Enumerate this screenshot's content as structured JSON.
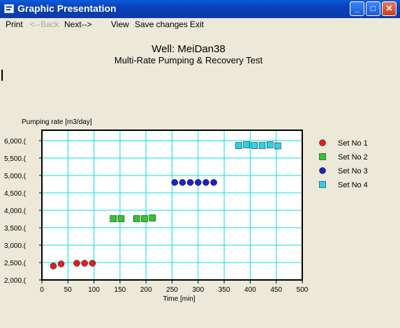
{
  "window": {
    "title": "Graphic Presentation",
    "buttons": {
      "minimize": "_",
      "maximize": "□",
      "close": "✕"
    }
  },
  "menu": {
    "print": "Print",
    "back": "<--Back",
    "next": "Next-->",
    "view": "View",
    "save_changes": "Save changes",
    "exit": "Exit"
  },
  "chart_data": {
    "type": "scatter",
    "title": "Well: MeiDan38",
    "subtitle": "Multi-Rate Pumping & Recovery Test",
    "ylabel": "Pumping rate [m3/day]",
    "xlabel": "Time [min]",
    "xlim": [
      0,
      500
    ],
    "ylim": [
      2000,
      6300
    ],
    "xticks": [
      0,
      50,
      100,
      150,
      200,
      250,
      300,
      350,
      400,
      450,
      500
    ],
    "yticks": [
      2000,
      2500,
      3000,
      3500,
      4000,
      4500,
      5000,
      5500,
      6000
    ],
    "ytick_labels": [
      "2,000.(",
      "2,500.(",
      "3,000.(",
      "3,500.(",
      "4,000.(",
      "4,500.(",
      "5,000.(",
      "5,500.(",
      "6,000.("
    ],
    "grid": true,
    "grid_color": "#00E0E0",
    "legend_position": "right",
    "series": [
      {
        "name": "Set No 1",
        "marker": "circle",
        "color": "#E0201E",
        "x": [
          22,
          37,
          67,
          82,
          97
        ],
        "y": [
          2400,
          2460,
          2480,
          2480,
          2480
        ]
      },
      {
        "name": "Set No 2",
        "marker": "square",
        "color": "#2EC82E",
        "x": [
          137,
          152,
          182,
          197,
          212
        ],
        "y": [
          3760,
          3760,
          3760,
          3760,
          3780
        ]
      },
      {
        "name": "Set No 3",
        "marker": "circle",
        "color": "#1A22C8",
        "x": [
          255,
          270,
          285,
          300,
          315,
          330
        ],
        "y": [
          4800,
          4800,
          4800,
          4800,
          4800,
          4800
        ]
      },
      {
        "name": "Set No 4",
        "marker": "square",
        "color": "#2ED0E6",
        "x": [
          378,
          393,
          408,
          423,
          438,
          453
        ],
        "y": [
          5860,
          5880,
          5860,
          5860,
          5880,
          5850
        ]
      }
    ]
  }
}
